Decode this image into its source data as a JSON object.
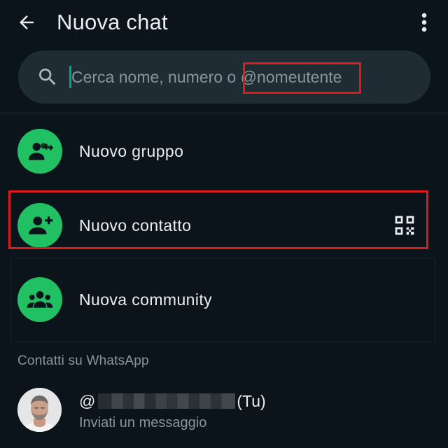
{
  "header": {
    "title": "Nuova chat",
    "back_icon": "arrow-left-icon",
    "menu_icon": "more-vertical-icon"
  },
  "search": {
    "placeholder": "Cerca nome, numero o @nomeutente",
    "value": "",
    "icon": "search-icon"
  },
  "actions": [
    {
      "label": "Nuovo gruppo",
      "icon": "group-add-icon"
    },
    {
      "label": "Nuovo contatto",
      "icon": "person-add-icon",
      "trailing_icon": "qr-code-icon"
    },
    {
      "label": "Nuova community",
      "icon": "community-icon"
    }
  ],
  "section": {
    "title": "Contatti su WhatsApp"
  },
  "contacts": [
    {
      "name_prefix": "@",
      "name_suffix": "(Tu)",
      "status": "Inviati un messaggio"
    }
  ],
  "colors": {
    "background": "#0b141a",
    "search_bg": "#1f2c34",
    "accent": "#21c063",
    "caret": "#00a884",
    "highlight": "#e01a1a",
    "primary_text": "#e9edef",
    "secondary_text": "#8696a0"
  }
}
